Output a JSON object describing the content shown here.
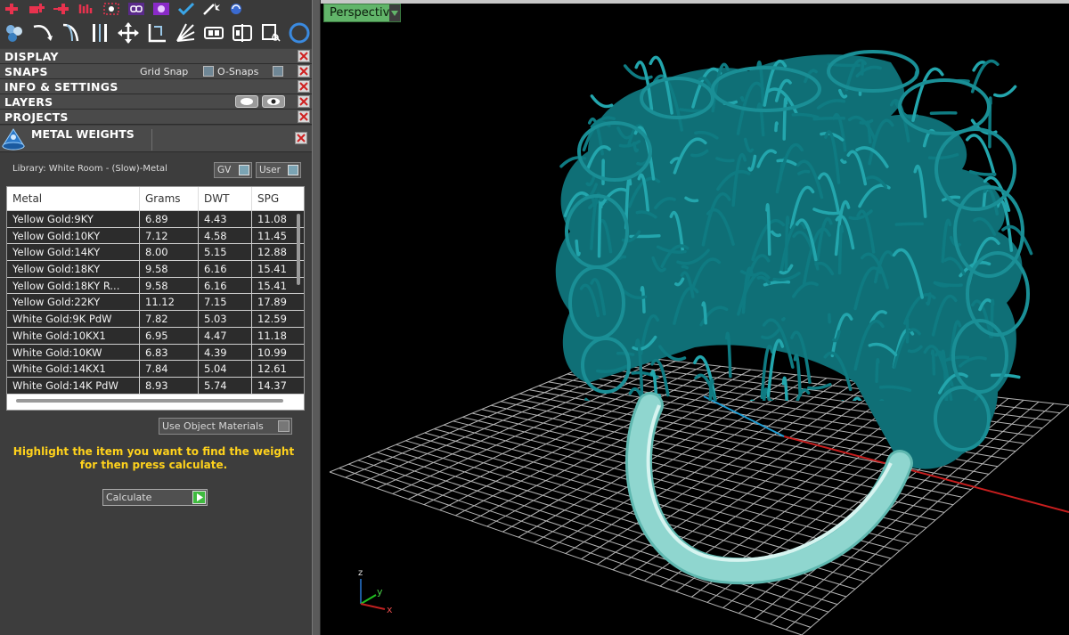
{
  "toolbar_icons_row1": [
    "add-point-icon",
    "add-object-icon",
    "move-add-icon",
    "nudge-icon",
    "frame-select-icon",
    "link-icon",
    "paint-icon",
    "checkmark-icon",
    "magic-wand-icon",
    "rotate-view-icon"
  ],
  "toolbar_icons_row2": [
    "boolean-icon",
    "curve-icon",
    "sweep-icon",
    "mirror-icon",
    "move-icon",
    "corner-icon",
    "burst-icon",
    "group-icon",
    "align-icon",
    "trim-icon",
    "circle-icon"
  ],
  "sections": {
    "display": "DISPLAY",
    "snaps": "SNAPS",
    "grid_snap": "Grid Snap",
    "o_snaps": "O-Snaps",
    "info": "INFO & SETTINGS",
    "layers": "LAYERS",
    "projects": "PROJECTS"
  },
  "metal_weights": {
    "title": "METAL WEIGHTS",
    "library": "Library: White Room - (Slow)-Metal",
    "gv_label": "GV",
    "user_label": "User",
    "columns": [
      "Metal",
      "Grams",
      "DWT",
      "SPG"
    ],
    "rows": [
      {
        "metal": "Yellow Gold:9KY",
        "grams": "6.89",
        "dwt": "4.43",
        "spg": "11.08"
      },
      {
        "metal": "Yellow Gold:10KY",
        "grams": "7.12",
        "dwt": "4.58",
        "spg": "11.45"
      },
      {
        "metal": "Yellow Gold:14KY",
        "grams": "8.00",
        "dwt": "5.15",
        "spg": "12.88"
      },
      {
        "metal": "Yellow Gold:18KY",
        "grams": "9.58",
        "dwt": "6.16",
        "spg": "15.41"
      },
      {
        "metal": "Yellow Gold:18KY R...",
        "grams": "9.58",
        "dwt": "6.16",
        "spg": "15.41"
      },
      {
        "metal": "Yellow Gold:22KY",
        "grams": "11.12",
        "dwt": "7.15",
        "spg": "17.89"
      },
      {
        "metal": "White Gold:9K PdW",
        "grams": "7.82",
        "dwt": "5.03",
        "spg": "12.59"
      },
      {
        "metal": "White Gold:10KX1",
        "grams": "6.95",
        "dwt": "4.47",
        "spg": "11.18"
      },
      {
        "metal": "White Gold:10KW",
        "grams": "6.83",
        "dwt": "4.39",
        "spg": "10.99"
      },
      {
        "metal": "White Gold:14KX1",
        "grams": "7.84",
        "dwt": "5.04",
        "spg": "12.61"
      },
      {
        "metal": "White Gold:14K PdW",
        "grams": "8.93",
        "dwt": "5.74",
        "spg": "14.37"
      }
    ],
    "use_object_materials": "Use Object Materials",
    "hint": "Highlight the item you want to find the weight for then press calculate.",
    "calculate": "Calculate"
  },
  "viewport": {
    "view_name": "Perspective",
    "axis_labels": {
      "z": "z",
      "y": "y",
      "x": "x"
    }
  },
  "colors": {
    "panel_bg": "#3d3d3d",
    "section_bg": "#4a4a4a",
    "hint_text": "#ffd21c",
    "viewport_tab": "#62b56a",
    "ring_lattice": "#0f7b82",
    "ring_shank": "#8fd6cf",
    "grid": "#b4b4b4",
    "x_axis": "#c81e1e",
    "y_axis": "#1e9bd2"
  }
}
